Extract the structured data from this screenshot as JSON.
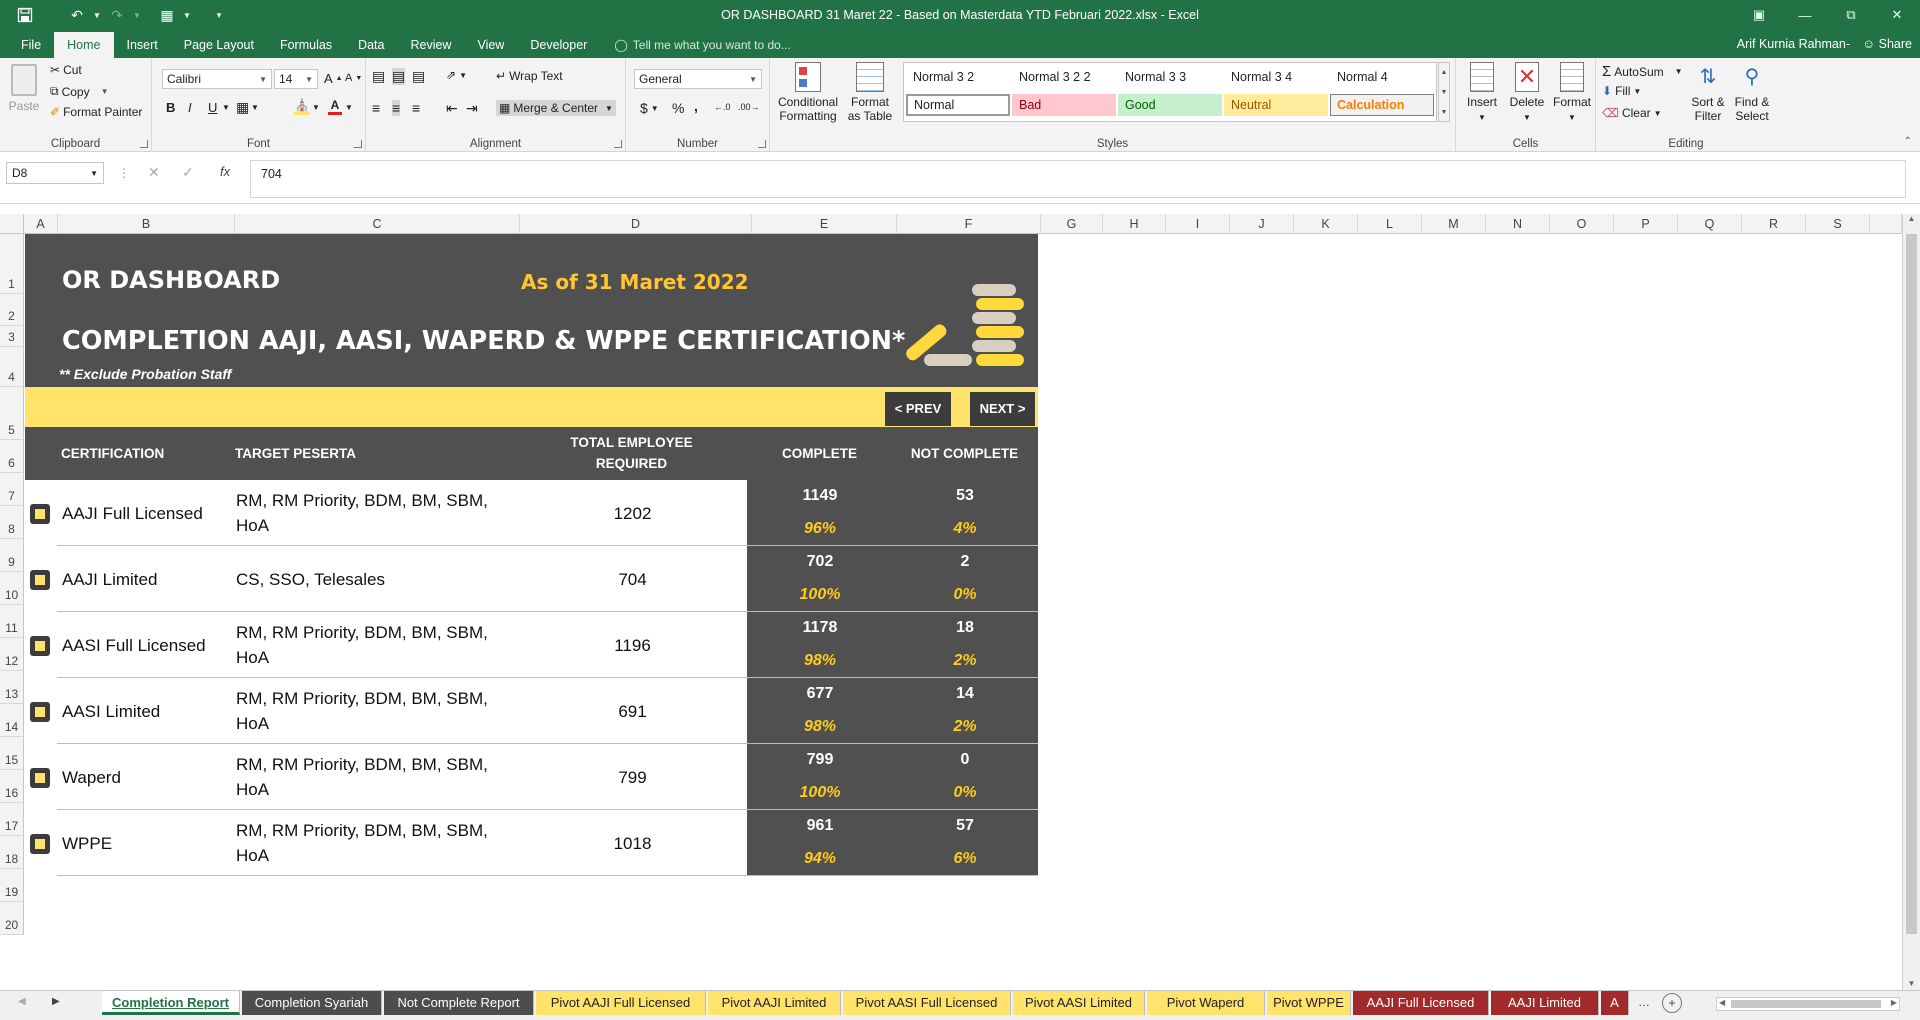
{
  "window": {
    "title": "OR DASHBOARD 31 Maret 22 - Based on Masterdata YTD Februari 2022.xlsx - Excel",
    "user": "Arif Kurnia Rahman-",
    "share": "Share"
  },
  "tabs": [
    "File",
    "Home",
    "Insert",
    "Page Layout",
    "Formulas",
    "Data",
    "Review",
    "View",
    "Developer"
  ],
  "tell_me": "Tell me what you want to do...",
  "ribbon": {
    "clipboard": {
      "paste": "Paste",
      "cut": "Cut",
      "copy": "Copy",
      "format_painter": "Format Painter",
      "label": "Clipboard"
    },
    "font": {
      "name": "Calibri",
      "size": "14",
      "label": "Font"
    },
    "alignment": {
      "wrap": "Wrap Text",
      "merge": "Merge & Center",
      "label": "Alignment"
    },
    "number": {
      "format": "General",
      "currency": "$",
      "percent": "%",
      "comma": ",",
      "label": "Number"
    },
    "styles": {
      "conditional": "Conditional Formatting",
      "format_table": "Format as Table",
      "label": "Styles",
      "gallery_top": [
        "Normal 3 2",
        "Normal 3 2 2",
        "Normal 3 3",
        "Normal 3 4",
        "Normal 4"
      ],
      "gallery_bottom": [
        "Normal",
        "Bad",
        "Good",
        "Neutral",
        "Calculation"
      ]
    },
    "cells": {
      "insert": "Insert",
      "delete": "Delete",
      "format": "Format",
      "label": "Cells"
    },
    "editing": {
      "autosum": "AutoSum",
      "fill": "Fill",
      "clear": "Clear",
      "sort": "Sort & Filter",
      "find": "Find & Select",
      "label": "Editing"
    }
  },
  "formula_bar": {
    "cell": "D8",
    "value": "704"
  },
  "columns": [
    "A",
    "B",
    "C",
    "D",
    "E",
    "F",
    "G",
    "H",
    "I",
    "J",
    "K",
    "L",
    "M",
    "N",
    "O",
    "P",
    "Q",
    "R",
    "S"
  ],
  "rows": [
    "1",
    "2",
    "3",
    "4",
    "5",
    "6",
    "7",
    "8",
    "9",
    "10",
    "11",
    "12",
    "13",
    "14",
    "15",
    "16",
    "17",
    "18",
    "19",
    "20"
  ],
  "dashboard": {
    "title": "OR DASHBOARD",
    "as_of": "As of 31 Maret 2022",
    "subtitle": "COMPLETION AAJI, AASI, WAPERD & WPPE CERTIFICATION*",
    "note": "** Exclude Probation Staff",
    "prev": "< PREV",
    "next": "NEXT >",
    "headers": {
      "certification": "CERTIFICATION",
      "target": "TARGET PESERTA",
      "total_1": "TOTAL EMPLOYEE",
      "total_2": "REQUIRED",
      "complete": "COMPLETE",
      "not_complete": "NOT COMPLETE"
    },
    "rows": [
      {
        "cert": "AAJI Full Licensed",
        "target_1": "RM, RM Priority, BDM, BM, SBM,",
        "target_2": "HoA",
        "total": "1202",
        "complete": "1149",
        "complete_pct": "96%",
        "not_complete": "53",
        "not_complete_pct": "4%"
      },
      {
        "cert": "AAJI Limited",
        "target_1": "CS, SSO, Telesales",
        "target_2": "",
        "total": "704",
        "complete": "702",
        "complete_pct": "100%",
        "not_complete": "2",
        "not_complete_pct": "0%"
      },
      {
        "cert": "AASI Full Licensed",
        "target_1": "RM, RM Priority, BDM, BM, SBM,",
        "target_2": "HoA",
        "total": "1196",
        "complete": "1178",
        "complete_pct": "98%",
        "not_complete": "18",
        "not_complete_pct": "2%"
      },
      {
        "cert": "AASI Limited",
        "target_1": "RM, RM Priority, BDM, BM, SBM,",
        "target_2": "HoA",
        "total": "691",
        "complete": "677",
        "complete_pct": "98%",
        "not_complete": "14",
        "not_complete_pct": "2%"
      },
      {
        "cert": "Waperd",
        "target_1": "RM, RM Priority, BDM, BM, SBM,",
        "target_2": "HoA",
        "total": "799",
        "complete": "799",
        "complete_pct": "100%",
        "not_complete": "0",
        "not_complete_pct": "0%"
      },
      {
        "cert": "WPPE",
        "target_1": "RM, RM Priority, BDM, BM, SBM,",
        "target_2": "HoA",
        "total": "1018",
        "complete": "961",
        "complete_pct": "94%",
        "not_complete": "57",
        "not_complete_pct": "6%"
      }
    ]
  },
  "sheet_tabs": [
    {
      "label": "Completion Report",
      "color": "#ffffff",
      "text": "#217346"
    },
    {
      "label": "Completion Syariah",
      "color": "#4d4d4d",
      "text": "#ffffff"
    },
    {
      "label": "Not Complete Report",
      "color": "#4d4d4d",
      "text": "#ffffff"
    },
    {
      "label": "Pivot AAJI Full Licensed",
      "color": "#ffe36b",
      "text": "#222222"
    },
    {
      "label": "Pivot AAJI Limited",
      "color": "#ffe36b",
      "text": "#222222"
    },
    {
      "label": "Pivot AASI Full Licensed",
      "color": "#ffe36b",
      "text": "#222222"
    },
    {
      "label": "Pivot AASI Limited",
      "color": "#ffe36b",
      "text": "#222222"
    },
    {
      "label": "Pivot Waperd",
      "color": "#ffe36b",
      "text": "#222222"
    },
    {
      "label": "Pivot WPPE",
      "color": "#ffe36b",
      "text": "#222222"
    },
    {
      "label": "AAJI Full Licensed",
      "color": "#a32a2a",
      "text": "#ffffff"
    },
    {
      "label": "AAJI Limited",
      "color": "#a32a2a",
      "text": "#ffffff"
    },
    {
      "label": "A",
      "color": "#a32a2a",
      "text": "#ffffff"
    }
  ],
  "colors": {
    "excel_green": "#217346",
    "dash_dark": "#505050",
    "dash_yellow": "#ffe36b",
    "accent_yellow": "#ffcc1a"
  }
}
